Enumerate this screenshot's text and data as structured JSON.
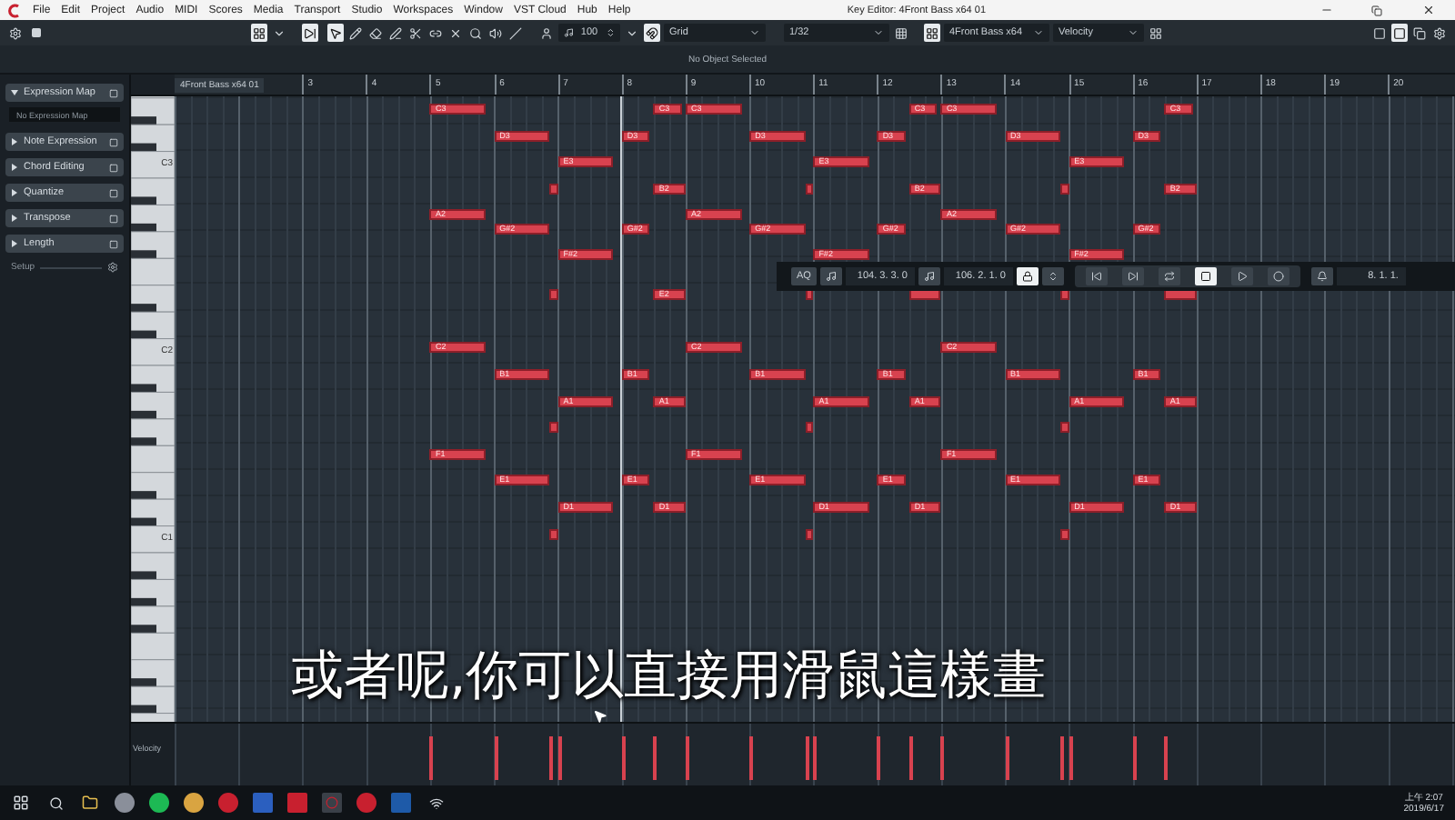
{
  "title_bar": {
    "menu": [
      "File",
      "Edit",
      "Project",
      "Audio",
      "MIDI",
      "Scores",
      "Media",
      "Transport",
      "Studio",
      "Workspaces",
      "Window",
      "VST Cloud",
      "Hub",
      "Help"
    ],
    "title": "Key Editor: 4Front Bass x64 01"
  },
  "toolbar": {
    "tools": [
      {
        "kind": "pointer",
        "selected": true
      },
      {
        "kind": "pencil",
        "selected": false
      },
      {
        "kind": "eraser",
        "selected": false
      },
      {
        "kind": "line",
        "selected": false
      },
      {
        "kind": "split",
        "selected": false
      },
      {
        "kind": "glue",
        "selected": false
      },
      {
        "kind": "mute",
        "selected": false
      },
      {
        "kind": "zoom",
        "selected": false
      },
      {
        "kind": "speaker",
        "selected": false
      },
      {
        "kind": "draw",
        "selected": false
      }
    ],
    "insert_velocity": "100",
    "snap_type": "Grid",
    "quantize": "1/32",
    "track": "4Front Bass x64",
    "controller_lane": "Velocity"
  },
  "info_line": "No Object Selected",
  "inspector": {
    "sections": [
      {
        "label": "Expression Map",
        "expanded": true,
        "field": "No Expression Map"
      },
      {
        "label": "Note Expression",
        "expanded": false
      },
      {
        "label": "Chord Editing",
        "expanded": false
      },
      {
        "label": "Quantize",
        "expanded": false
      },
      {
        "label": "Transpose",
        "expanded": false
      },
      {
        "label": "Length",
        "expanded": false
      }
    ],
    "setup": "Setup"
  },
  "ruler": {
    "part_name": "4Front Bass x64 01",
    "bars": [
      "3",
      "4",
      "5",
      "6",
      "7",
      "8",
      "9",
      "10",
      "11",
      "12",
      "13",
      "14",
      "15",
      "16",
      "17",
      "18",
      "19",
      "20"
    ]
  },
  "keyboard": {
    "labels": [
      "C3",
      "C2",
      "C1"
    ]
  },
  "note_rows": [
    [
      "C3",
      "C3",
      "C3",
      "C3",
      "C3",
      "C3"
    ],
    [
      "D3",
      "D3",
      "D3",
      "D3",
      "D3",
      "D3"
    ],
    [
      "E3",
      "E3",
      "E3"
    ],
    [
      "B2",
      "B2",
      "B2"
    ],
    [
      "A2",
      "A2",
      "A2"
    ],
    [
      "G#2",
      "G#2",
      "G#2",
      "G#2",
      "G#2",
      "G#2"
    ],
    [
      "F#2",
      "F#2",
      "F#2"
    ],
    [
      "E2"
    ],
    [
      "C2",
      "C2",
      "C2"
    ],
    [
      "B1",
      "B1",
      "B1",
      "B1",
      "B1",
      "B1"
    ],
    [
      "A1",
      "A1",
      "A1",
      "A1",
      "A1",
      "A1"
    ],
    [
      "F1",
      "F1",
      "F1"
    ],
    [
      "E1",
      "E1",
      "E1",
      "E1",
      "E1",
      "E1"
    ],
    [
      "D1",
      "D1",
      "D1",
      "D1",
      "D1",
      "D1"
    ]
  ],
  "velocity_lane": {
    "label": "Velocity"
  },
  "transport_bar": {
    "auto_quantize": "AQ",
    "left_locator": "104. 3. 3. 0",
    "right_locator": "106. 2. 1. 0",
    "lock": true,
    "buttons": [
      {
        "kind": "start",
        "selected": false
      },
      {
        "kind": "end",
        "selected": false
      },
      {
        "kind": "cycle",
        "selected": false
      },
      {
        "kind": "stop",
        "selected": true
      },
      {
        "kind": "play",
        "selected": false
      },
      {
        "kind": "record",
        "selected": false
      }
    ],
    "position": "8. 1. 1."
  },
  "subtitle": "或者呢,你可以直接用滑鼠這樣畫",
  "taskbar": {
    "time": "上午 2:07",
    "date": "2019/6/17"
  }
}
